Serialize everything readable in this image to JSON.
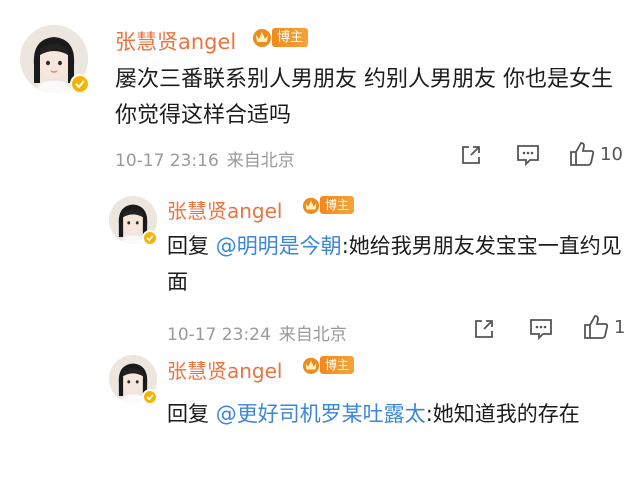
{
  "comments": [
    {
      "username": "张慧贤angel",
      "medal": "博主",
      "text": "屡次三番联系别人男朋友 约别人男朋友 你也是女生 你觉得这样合适吗",
      "time": "10-17 23:16",
      "source": "来自北京",
      "likes": "10"
    },
    {
      "username": "张慧贤angel",
      "medal": "博主",
      "reply_prefix": "回复",
      "mention": "@明明是今朝",
      "text": ":她给我男朋友发宝宝一直约见面",
      "time": "10-17 23:24",
      "source": "来自北京",
      "likes": "1"
    },
    {
      "username": "张慧贤angel",
      "medal": "博主",
      "reply_prefix": "回复",
      "mention": "@更好司机罗某吐露太",
      "text": ":她知道我的存在"
    }
  ],
  "icons": {
    "share": "share-icon",
    "reply": "comment-icon",
    "like": "thumbs-up-icon",
    "verified": "verified-badge-icon",
    "crown": "crown-icon"
  },
  "colors": {
    "username": "#eb7340",
    "mention": "#3b87d9",
    "meta": "#9a9a9a",
    "verified": "#f5b400",
    "medal": "#f08a1e"
  }
}
